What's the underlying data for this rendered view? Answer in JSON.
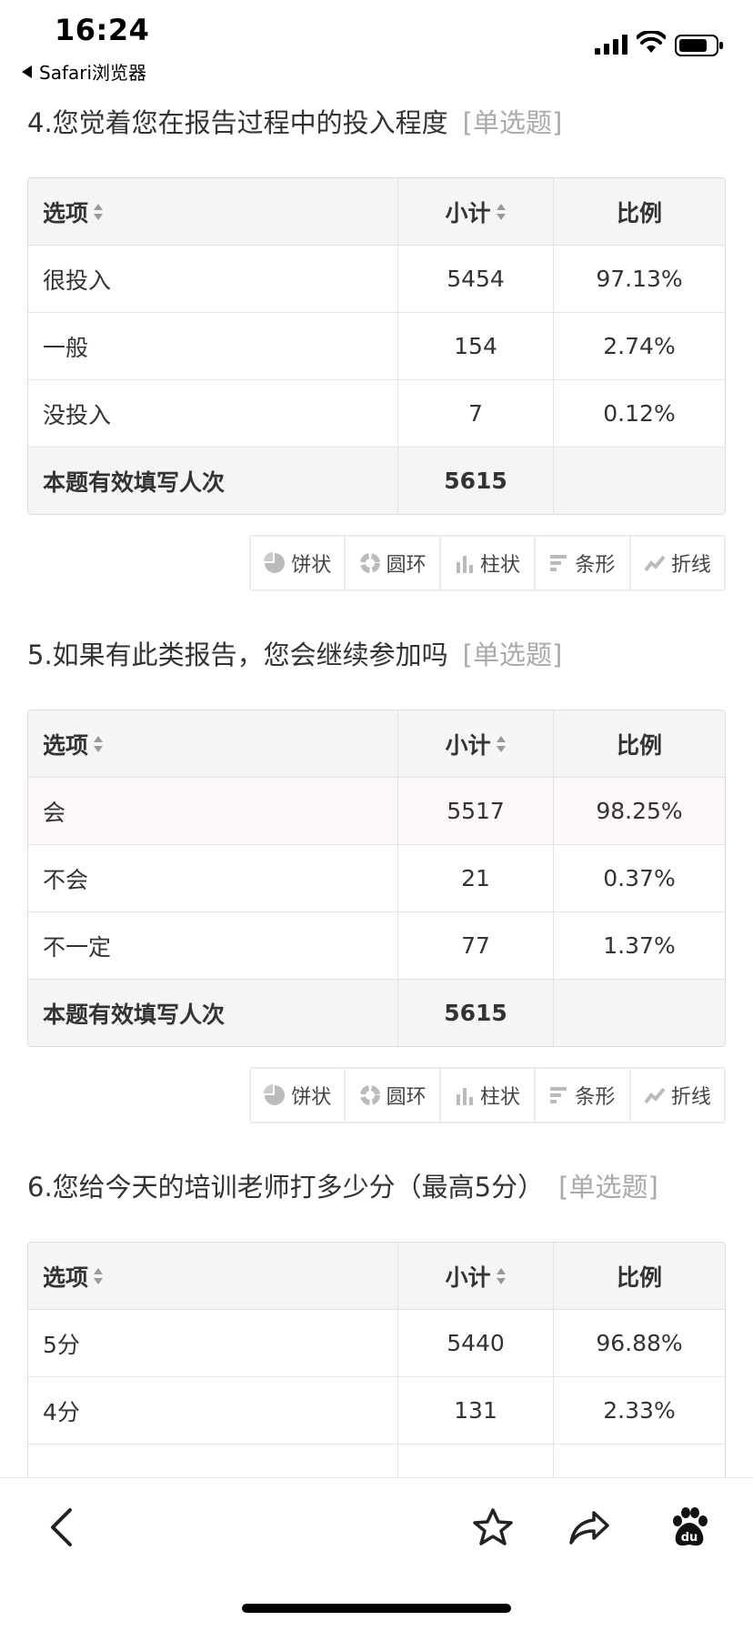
{
  "status_bar": {
    "time": "16:24",
    "back_app": "Safari浏览器"
  },
  "chart_tabs": [
    "饼状",
    "圆环",
    "柱状",
    "条形",
    "折线"
  ],
  "questions": [
    {
      "title": "4.您觉着您在报告过程中的投入程度",
      "tag": "[单选题]",
      "header": {
        "option": "选项",
        "count": "小计",
        "ratio": "比例"
      },
      "rows": [
        {
          "option": "很投入",
          "count": "5454",
          "ratio": "97.13%"
        },
        {
          "option": "一般",
          "count": "154",
          "ratio": "2.74%"
        },
        {
          "option": "没投入",
          "count": "7",
          "ratio": "0.12%"
        }
      ],
      "total": {
        "label": "本题有效填写人次",
        "count": "5615"
      }
    },
    {
      "title": "5.如果有此类报告，您会继续参加吗",
      "tag": "[单选题]",
      "header": {
        "option": "选项",
        "count": "小计",
        "ratio": "比例"
      },
      "rows": [
        {
          "option": "会",
          "count": "5517",
          "ratio": "98.25%"
        },
        {
          "option": "不会",
          "count": "21",
          "ratio": "0.37%"
        },
        {
          "option": "不一定",
          "count": "77",
          "ratio": "1.37%"
        }
      ],
      "total": {
        "label": "本题有效填写人次",
        "count": "5615"
      }
    },
    {
      "title": "6.您给今天的培训老师打多少分（最高5分）",
      "tag": "[单选题]",
      "header": {
        "option": "选项",
        "count": "小计",
        "ratio": "比例"
      },
      "rows": [
        {
          "option": "5分",
          "count": "5440",
          "ratio": "96.88%"
        },
        {
          "option": "4分",
          "count": "131",
          "ratio": "2.33%"
        }
      ]
    }
  ],
  "icons": {
    "back": "chevron-left-icon",
    "favorite": "star-icon",
    "share": "share-arrow-icon",
    "baidu": "baidu-paw-icon"
  }
}
